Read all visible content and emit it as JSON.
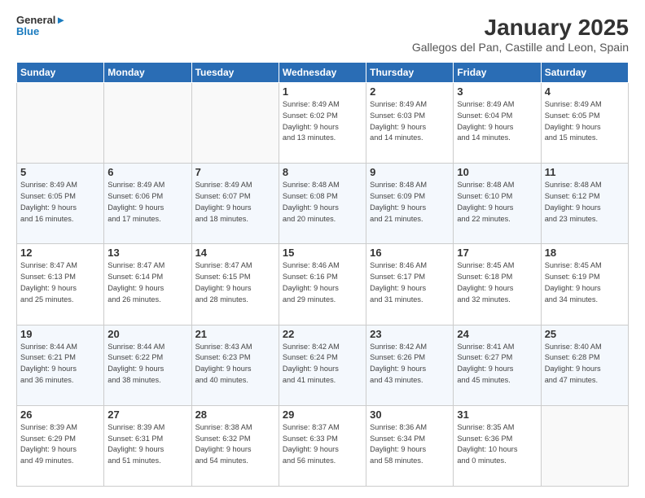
{
  "logo": {
    "line1": "General",
    "line2": "Blue"
  },
  "title": "January 2025",
  "subtitle": "Gallegos del Pan, Castille and Leon, Spain",
  "days_header": [
    "Sunday",
    "Monday",
    "Tuesday",
    "Wednesday",
    "Thursday",
    "Friday",
    "Saturday"
  ],
  "weeks": [
    [
      {
        "day": "",
        "info": ""
      },
      {
        "day": "",
        "info": ""
      },
      {
        "day": "",
        "info": ""
      },
      {
        "day": "1",
        "info": "Sunrise: 8:49 AM\nSunset: 6:02 PM\nDaylight: 9 hours\nand 13 minutes."
      },
      {
        "day": "2",
        "info": "Sunrise: 8:49 AM\nSunset: 6:03 PM\nDaylight: 9 hours\nand 14 minutes."
      },
      {
        "day": "3",
        "info": "Sunrise: 8:49 AM\nSunset: 6:04 PM\nDaylight: 9 hours\nand 14 minutes."
      },
      {
        "day": "4",
        "info": "Sunrise: 8:49 AM\nSunset: 6:05 PM\nDaylight: 9 hours\nand 15 minutes."
      }
    ],
    [
      {
        "day": "5",
        "info": "Sunrise: 8:49 AM\nSunset: 6:05 PM\nDaylight: 9 hours\nand 16 minutes."
      },
      {
        "day": "6",
        "info": "Sunrise: 8:49 AM\nSunset: 6:06 PM\nDaylight: 9 hours\nand 17 minutes."
      },
      {
        "day": "7",
        "info": "Sunrise: 8:49 AM\nSunset: 6:07 PM\nDaylight: 9 hours\nand 18 minutes."
      },
      {
        "day": "8",
        "info": "Sunrise: 8:48 AM\nSunset: 6:08 PM\nDaylight: 9 hours\nand 20 minutes."
      },
      {
        "day": "9",
        "info": "Sunrise: 8:48 AM\nSunset: 6:09 PM\nDaylight: 9 hours\nand 21 minutes."
      },
      {
        "day": "10",
        "info": "Sunrise: 8:48 AM\nSunset: 6:10 PM\nDaylight: 9 hours\nand 22 minutes."
      },
      {
        "day": "11",
        "info": "Sunrise: 8:48 AM\nSunset: 6:12 PM\nDaylight: 9 hours\nand 23 minutes."
      }
    ],
    [
      {
        "day": "12",
        "info": "Sunrise: 8:47 AM\nSunset: 6:13 PM\nDaylight: 9 hours\nand 25 minutes."
      },
      {
        "day": "13",
        "info": "Sunrise: 8:47 AM\nSunset: 6:14 PM\nDaylight: 9 hours\nand 26 minutes."
      },
      {
        "day": "14",
        "info": "Sunrise: 8:47 AM\nSunset: 6:15 PM\nDaylight: 9 hours\nand 28 minutes."
      },
      {
        "day": "15",
        "info": "Sunrise: 8:46 AM\nSunset: 6:16 PM\nDaylight: 9 hours\nand 29 minutes."
      },
      {
        "day": "16",
        "info": "Sunrise: 8:46 AM\nSunset: 6:17 PM\nDaylight: 9 hours\nand 31 minutes."
      },
      {
        "day": "17",
        "info": "Sunrise: 8:45 AM\nSunset: 6:18 PM\nDaylight: 9 hours\nand 32 minutes."
      },
      {
        "day": "18",
        "info": "Sunrise: 8:45 AM\nSunset: 6:19 PM\nDaylight: 9 hours\nand 34 minutes."
      }
    ],
    [
      {
        "day": "19",
        "info": "Sunrise: 8:44 AM\nSunset: 6:21 PM\nDaylight: 9 hours\nand 36 minutes."
      },
      {
        "day": "20",
        "info": "Sunrise: 8:44 AM\nSunset: 6:22 PM\nDaylight: 9 hours\nand 38 minutes."
      },
      {
        "day": "21",
        "info": "Sunrise: 8:43 AM\nSunset: 6:23 PM\nDaylight: 9 hours\nand 40 minutes."
      },
      {
        "day": "22",
        "info": "Sunrise: 8:42 AM\nSunset: 6:24 PM\nDaylight: 9 hours\nand 41 minutes."
      },
      {
        "day": "23",
        "info": "Sunrise: 8:42 AM\nSunset: 6:26 PM\nDaylight: 9 hours\nand 43 minutes."
      },
      {
        "day": "24",
        "info": "Sunrise: 8:41 AM\nSunset: 6:27 PM\nDaylight: 9 hours\nand 45 minutes."
      },
      {
        "day": "25",
        "info": "Sunrise: 8:40 AM\nSunset: 6:28 PM\nDaylight: 9 hours\nand 47 minutes."
      }
    ],
    [
      {
        "day": "26",
        "info": "Sunrise: 8:39 AM\nSunset: 6:29 PM\nDaylight: 9 hours\nand 49 minutes."
      },
      {
        "day": "27",
        "info": "Sunrise: 8:39 AM\nSunset: 6:31 PM\nDaylight: 9 hours\nand 51 minutes."
      },
      {
        "day": "28",
        "info": "Sunrise: 8:38 AM\nSunset: 6:32 PM\nDaylight: 9 hours\nand 54 minutes."
      },
      {
        "day": "29",
        "info": "Sunrise: 8:37 AM\nSunset: 6:33 PM\nDaylight: 9 hours\nand 56 minutes."
      },
      {
        "day": "30",
        "info": "Sunrise: 8:36 AM\nSunset: 6:34 PM\nDaylight: 9 hours\nand 58 minutes."
      },
      {
        "day": "31",
        "info": "Sunrise: 8:35 AM\nSunset: 6:36 PM\nDaylight: 10 hours\nand 0 minutes."
      },
      {
        "day": "",
        "info": ""
      }
    ]
  ]
}
